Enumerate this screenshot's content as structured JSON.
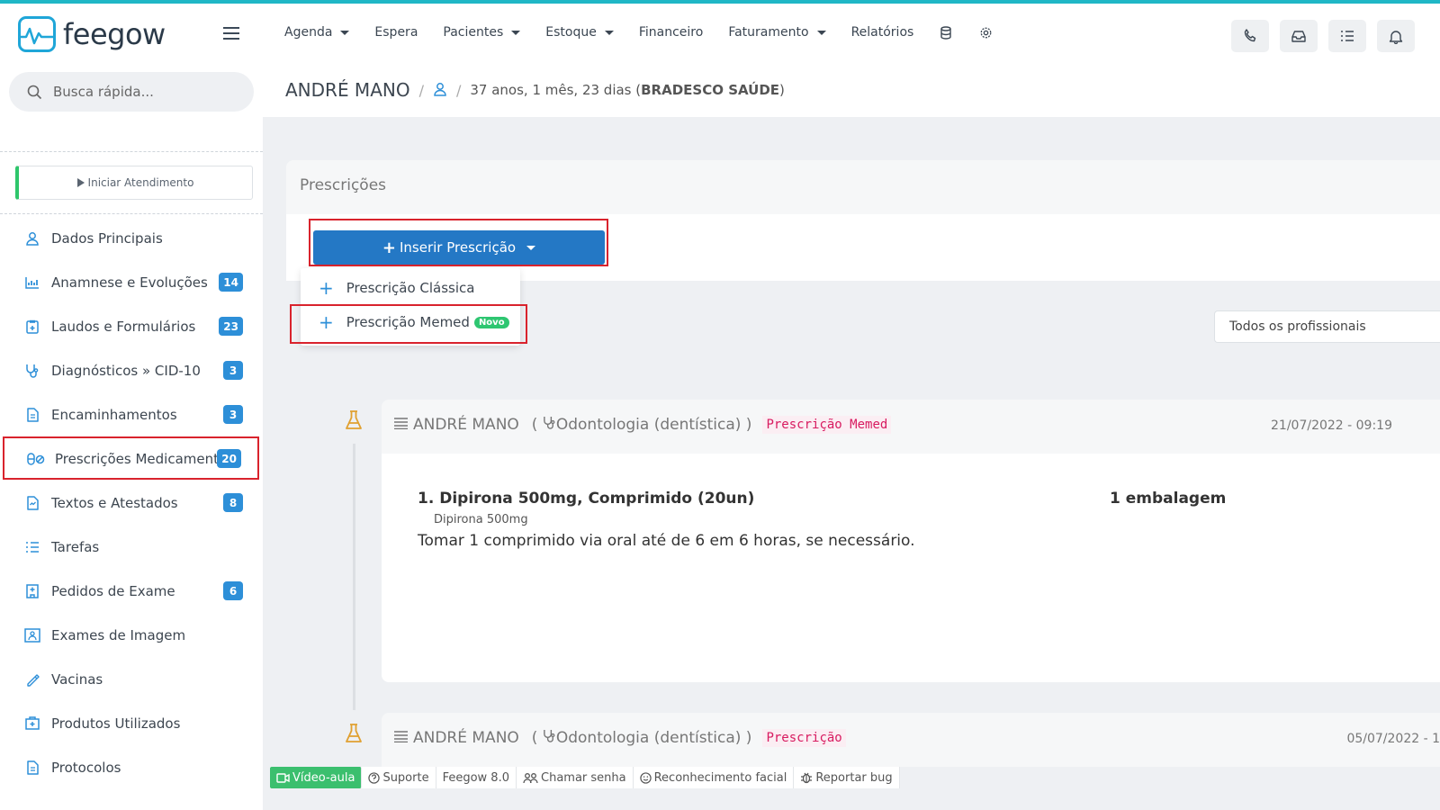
{
  "app": {
    "logo_text": "feegow"
  },
  "nav": {
    "items": [
      {
        "label": "Agenda",
        "dropdown": true
      },
      {
        "label": "Espera",
        "dropdown": false
      },
      {
        "label": "Pacientes",
        "dropdown": true
      },
      {
        "label": "Estoque",
        "dropdown": true
      },
      {
        "label": "Financeiro",
        "dropdown": false
      },
      {
        "label": "Faturamento",
        "dropdown": true
      },
      {
        "label": "Relatórios",
        "dropdown": false
      }
    ],
    "icons": [
      "database-icon",
      "settings-icon"
    ]
  },
  "topbar_buttons": [
    "phone-icon",
    "inbox-icon",
    "tasks-icon",
    "bell-icon"
  ],
  "search": {
    "placeholder": "Busca rápida..."
  },
  "sidebar": {
    "start_label": "Iniciar Atendimento",
    "items": [
      {
        "label": "Dados Principais",
        "icon": "user-icon",
        "badge": ""
      },
      {
        "label": "Anamnese e Evoluções",
        "icon": "chart-icon",
        "badge": "14"
      },
      {
        "label": "Laudos e Formulários",
        "icon": "clipboard-icon",
        "badge": "23"
      },
      {
        "label": "Diagnósticos » CID-10",
        "icon": "stethoscope-icon",
        "badge": "3"
      },
      {
        "label": "Encaminhamentos",
        "icon": "document-icon",
        "badge": "3"
      },
      {
        "label": "Prescrições Medicamentos",
        "icon": "pills-icon",
        "badge": "20"
      },
      {
        "label": "Textos e Atestados",
        "icon": "file-text-icon",
        "badge": "8"
      },
      {
        "label": "Tarefas",
        "icon": "tasks-icon",
        "badge": ""
      },
      {
        "label": "Pedidos de Exame",
        "icon": "hospital-icon",
        "badge": "6"
      },
      {
        "label": "Exames de Imagem",
        "icon": "image-icon",
        "badge": ""
      },
      {
        "label": "Vacinas",
        "icon": "syringe-icon",
        "badge": ""
      },
      {
        "label": "Produtos Utilizados",
        "icon": "box-icon",
        "badge": ""
      },
      {
        "label": "Protocolos",
        "icon": "file-icon",
        "badge": ""
      }
    ]
  },
  "patient": {
    "name": "ANDRÉ MANO",
    "age": "37 anos, 1 mês, 23 dias (",
    "insurance": "BRADESCO SAÚDE",
    "close_paren": ")"
  },
  "prescriptions": {
    "title": "Prescrições",
    "insert_label": "Inserir Prescrição",
    "dropdown": [
      {
        "label": "Prescrição Clássica",
        "badge": ""
      },
      {
        "label": "Prescrição Memed",
        "badge": "Novo"
      }
    ],
    "filter_value": "Todos os profissionais"
  },
  "timeline": [
    {
      "author": "ANDRÉ MANO",
      "specialty": "Odontologia (dentística)",
      "type": "Prescrição Memed",
      "date": "21/07/2022 - 09:19",
      "rx_title": "1. Dipirona 500mg, Comprimido (20un)",
      "rx_qty": "1 embalagem",
      "rx_sub": "Dipirona 500mg",
      "rx_inst": "Tomar 1 comprimido via oral até de 6 em 6 horas, se necessário."
    },
    {
      "author": "ANDRÉ MANO",
      "specialty": "Odontologia (dentística)",
      "type": "Prescrição",
      "date": "05/07/2022 - 1"
    }
  ],
  "footer": [
    {
      "label": "Vídeo-aula",
      "icon": "video-icon"
    },
    {
      "label": "Suporte",
      "icon": "help-icon"
    },
    {
      "label": "Feegow 8.0",
      "icon": ""
    },
    {
      "label": "Chamar senha",
      "icon": "users-icon"
    },
    {
      "label": "Reconhecimento facial",
      "icon": "smile-icon"
    },
    {
      "label": "Reportar bug",
      "icon": "bug-icon"
    }
  ],
  "colors": {
    "accent": "#2478c5",
    "badge": "#2d8fd8",
    "highlight": "#d9232d",
    "success": "#2ec671",
    "tag": "#d81b60"
  }
}
